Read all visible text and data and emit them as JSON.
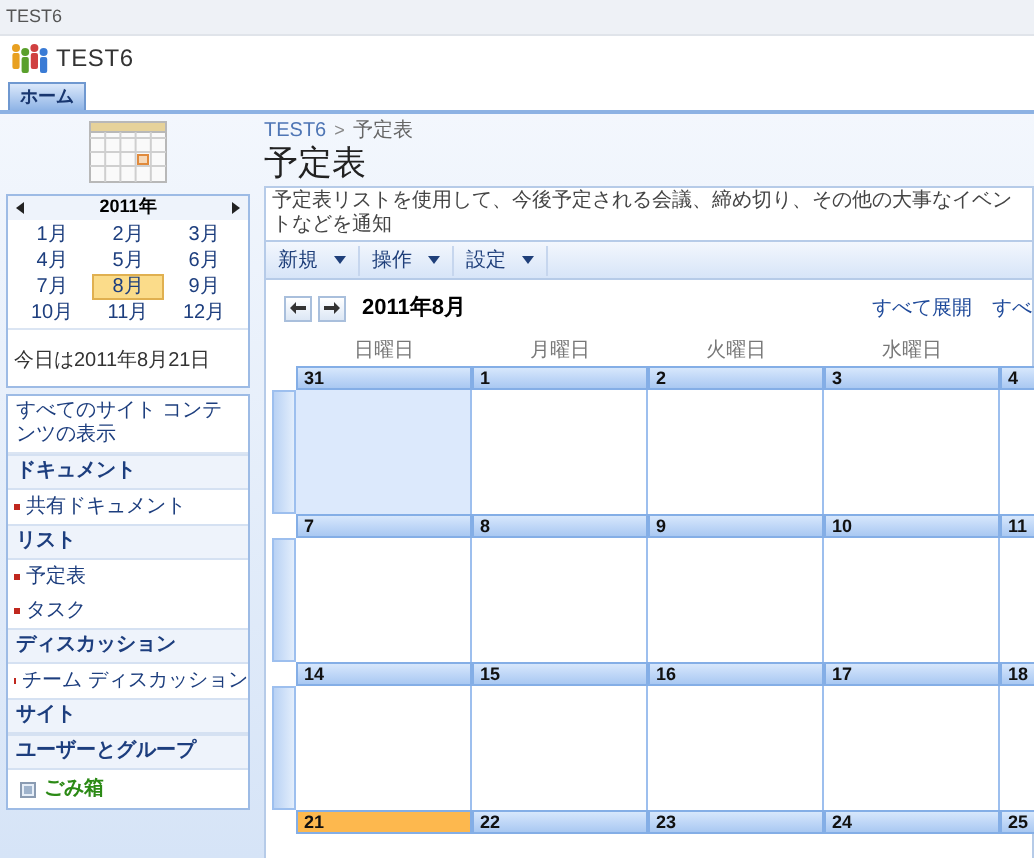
{
  "window": {
    "title": "TEST6"
  },
  "site": {
    "title": "TEST6"
  },
  "tabs": [
    {
      "label": "ホーム",
      "selected": true
    }
  ],
  "breadcrumb": {
    "parent": "TEST6",
    "separator": ">",
    "current": "予定表"
  },
  "page_title": "予定表",
  "year_calendar": {
    "year": "2011年",
    "months": [
      {
        "label": "1月",
        "selected": false
      },
      {
        "label": "2月",
        "selected": false
      },
      {
        "label": "3月",
        "selected": false
      },
      {
        "label": "4月",
        "selected": false
      },
      {
        "label": "5月",
        "selected": false
      },
      {
        "label": "6月",
        "selected": false
      },
      {
        "label": "7月",
        "selected": false
      },
      {
        "label": "8月",
        "selected": true
      },
      {
        "label": "9月",
        "selected": false
      },
      {
        "label": "10月",
        "selected": false
      },
      {
        "label": "11月",
        "selected": false
      },
      {
        "label": "12月",
        "selected": false
      }
    ],
    "today": "今日は2011年8月21日"
  },
  "sidebar": {
    "items": [
      {
        "kind": "link",
        "label": "すべてのサイト コンテンツの表示"
      },
      {
        "kind": "heading",
        "label": "ドキュメント"
      },
      {
        "kind": "item",
        "label": "共有ドキュメント"
      },
      {
        "kind": "heading",
        "label": "リスト"
      },
      {
        "kind": "item",
        "label": "予定表"
      },
      {
        "kind": "item",
        "label": "タスク"
      },
      {
        "kind": "heading",
        "label": "ディスカッション"
      },
      {
        "kind": "item",
        "label": "チーム ディスカッション"
      },
      {
        "kind": "heading",
        "label": "サイト"
      },
      {
        "kind": "heading",
        "label": "ユーザーとグループ"
      },
      {
        "kind": "recycle",
        "label": "ごみ箱"
      }
    ]
  },
  "description": "予定表リストを使用して、今後予定される会議、締め切り、その他の大事なイベントなどを通知",
  "toolbar": [
    {
      "label": "新規"
    },
    {
      "label": "操作"
    },
    {
      "label": "設定"
    }
  ],
  "calendar": {
    "month": "2011年8月",
    "links": [
      "すべて展開",
      "すべ"
    ],
    "weekdays": [
      "日曜日",
      "月曜日",
      "火曜日",
      "水曜日"
    ],
    "weeks": [
      [
        {
          "day": "31",
          "other_month": true,
          "today": false
        },
        {
          "day": "1",
          "other_month": false,
          "today": false
        },
        {
          "day": "2",
          "other_month": false,
          "today": false
        },
        {
          "day": "3",
          "other_month": false,
          "today": false
        },
        {
          "day": "4",
          "other_month": false,
          "today": false
        }
      ],
      [
        {
          "day": "7",
          "other_month": false,
          "today": false
        },
        {
          "day": "8",
          "other_month": false,
          "today": false
        },
        {
          "day": "9",
          "other_month": false,
          "today": false
        },
        {
          "day": "10",
          "other_month": false,
          "today": false
        },
        {
          "day": "11",
          "other_month": false,
          "today": false
        }
      ],
      [
        {
          "day": "14",
          "other_month": false,
          "today": false
        },
        {
          "day": "15",
          "other_month": false,
          "today": false
        },
        {
          "day": "16",
          "other_month": false,
          "today": false
        },
        {
          "day": "17",
          "other_month": false,
          "today": false
        },
        {
          "day": "18",
          "other_month": false,
          "today": false
        }
      ],
      [
        {
          "day": "21",
          "today": true
        },
        {
          "day": "22",
          "today": false
        },
        {
          "day": "23",
          "today": false
        },
        {
          "day": "24",
          "today": false
        },
        {
          "day": "25",
          "today": false
        }
      ]
    ]
  }
}
